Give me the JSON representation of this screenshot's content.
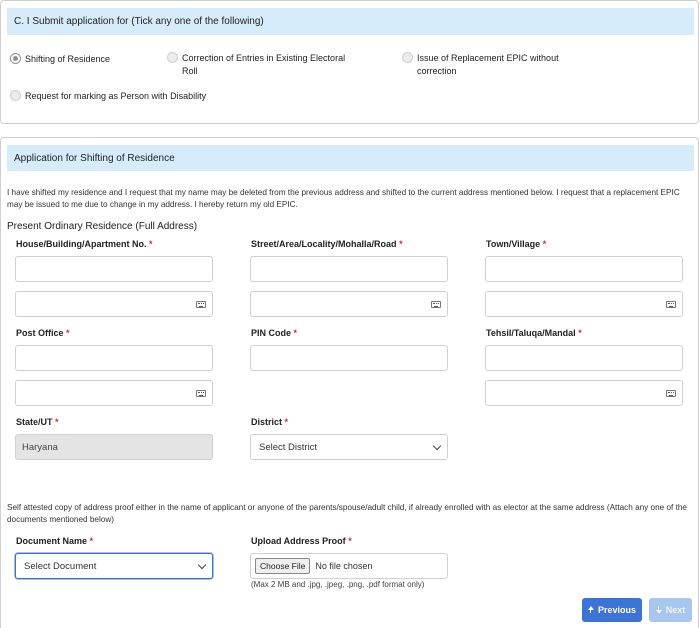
{
  "submit_section": {
    "title": "C. I Submit application for (Tick any one of the following)",
    "options": [
      {
        "label": "Shifting of Residence",
        "checked": true
      },
      {
        "label": "Correction of Entries in Existing Electoral Roll",
        "checked": false
      },
      {
        "label": "Issue of Replacement EPIC without correction",
        "checked": false
      },
      {
        "label": "Request for marking as Person with Disability",
        "checked": false
      }
    ],
    "option_lines": [
      [
        "Shifting of Residence"
      ],
      [
        "Correction of Entries in Existing Electoral",
        "Roll"
      ],
      [
        "Issue of Replacement EPIC without",
        "correction"
      ],
      [
        "Request for marking as Person with Disability"
      ]
    ]
  },
  "shifting_section": {
    "title": "Application for Shifting of Residence",
    "declaration_line1": "I have shifted my residence and I request that my name may be deleted from the previous address and shifted to the current address mentioned below. I request that a replacement EPIC",
    "declaration_line2": "may be issued to me due to change in my address. I hereby return my old EPIC.",
    "address_title": "Present Ordinary Residence (Full Address)",
    "fields": {
      "house": {
        "label": "House/Building/Apartment No.",
        "value": "",
        "alt_value": ""
      },
      "street": {
        "label": "Street/Area/Locality/Mohalla/Road",
        "value": "",
        "alt_value": ""
      },
      "town": {
        "label": "Town/Village",
        "value": "",
        "alt_value": ""
      },
      "post_office": {
        "label": "Post Office",
        "value": "",
        "alt_value": ""
      },
      "pin": {
        "label": "PIN Code",
        "value": ""
      },
      "tehsil": {
        "label": "Tehsil/Taluqa/Mandal",
        "value": "",
        "alt_value": ""
      },
      "state": {
        "label": "State/UT",
        "value": "Haryana"
      },
      "district": {
        "label": "District",
        "selected": "Select District"
      }
    },
    "required_mark": "*",
    "proof_note_line1": "Self attested copy of address proof either in the name of applicant or anyone of the parents/spouse/adult child, if already enrolled with as elector at the same address (Attach any one of the",
    "proof_note_line2": "documents mentioned below)",
    "document": {
      "label": "Document Name",
      "selected": "Select Document"
    },
    "upload": {
      "label": "Upload Address Proof",
      "button": "Choose File",
      "status": "No file chosen",
      "hint": "(Max 2 MB and .jpg, .jpeg, .png, .pdf format only)"
    }
  },
  "nav": {
    "previous": "Previous",
    "next": "Next"
  },
  "colors": {
    "section_header": "#d7ecfb",
    "primary": "#3b73d6",
    "disabled": "#a9c6ee",
    "required": "#d32f2f"
  }
}
